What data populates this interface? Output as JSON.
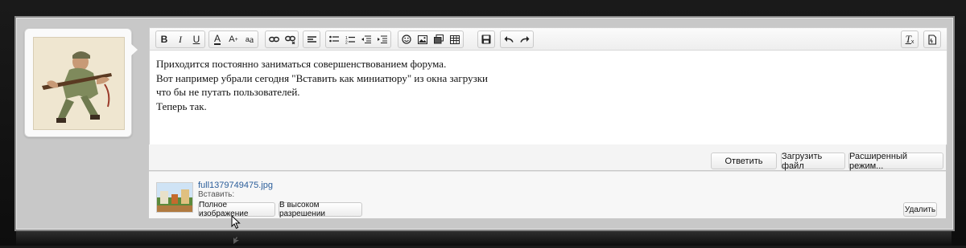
{
  "toolbar": {
    "bold": "B",
    "italic": "I",
    "underline": "U",
    "font_color": "A",
    "font_size": "A",
    "font_face": "a"
  },
  "post": {
    "lines": [
      "Приходится постоянно заниматься совершенствованием форума.",
      "Вот например убрали сегодня \"Вставить как миниатюру\" из окна загрузки",
      "что бы не путать пользователей.",
      "Теперь так."
    ]
  },
  "buttons": {
    "reply": "Ответить",
    "upload": "Загрузить файл",
    "advanced": "Расширенный режим..."
  },
  "attachment": {
    "filename": "full1379749475.jpg",
    "insert_label": "Вставить:",
    "full_image": "Полное изображение",
    "high_res": "В высоком разрешении",
    "delete": "Удалить"
  },
  "icons": [
    "bold-icon",
    "italic-icon",
    "underline-icon",
    "font-color-icon",
    "font-size-icon",
    "font-face-icon",
    "link-icon",
    "unlink-icon",
    "align-icon",
    "bullet-list-icon",
    "numbered-list-icon",
    "outdent-icon",
    "indent-icon",
    "smiley-icon",
    "image-icon",
    "gallery-icon",
    "table-icon",
    "save-icon",
    "undo-icon",
    "redo-icon",
    "clear-format-icon",
    "source-icon"
  ]
}
